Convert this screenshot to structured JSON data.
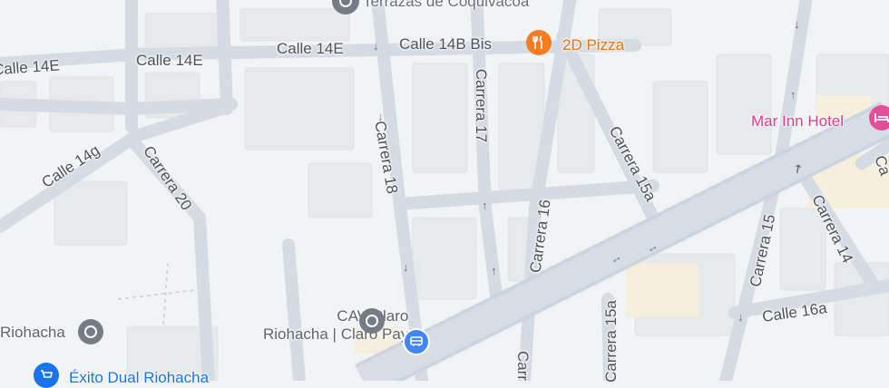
{
  "colors": {
    "land": "#f2f3f5",
    "block": "#e6e8eb",
    "road": "#d8dde3",
    "road_outline": "#cfd5dc",
    "main_road": "#c9d2dc",
    "label": "#4d5156",
    "poi_gray": "#757c85",
    "food": "#f57c1f",
    "hotel": "#e24e9a",
    "transit": "#4285f4",
    "shopping": "#1a73e8"
  },
  "streets": {
    "calle_14e_left": "Calle 14E",
    "calle_14e_mid": "Calle 14E",
    "calle_14e_right": "Calle 14E",
    "calle_14b_bis": "Calle 14B Bis",
    "calle_14g": "Calle 14g",
    "carrera_20": "Carrera 20",
    "carrera_18": "Carrera 18",
    "carrera_17": "Carrera 17",
    "carrera_16": "Carrera 16",
    "carrera_15a_top": "Carrera 15a",
    "carrera_15a_bottom": "Carrera 15a",
    "carrera_15": "Carrera 15",
    "carrera_14": "Carrera 14",
    "calle_16a": "Calle 16a",
    "carrera_cut_right": "Ca",
    "carrera_cut_bottom": "Carr"
  },
  "places": {
    "terrazas": {
      "name": "Terrazas de Coquivacoa",
      "icon": "pin-icon"
    },
    "pizza": {
      "name": "2D Pizza",
      "icon": "fork-knife-icon"
    },
    "hotel": {
      "name": "Mar Inn Hotel",
      "icon": "bed-icon"
    },
    "cav_claro": {
      "name_line1": "CAV Claro",
      "name_line2": "Riohacha | Claro Pay",
      "icon": "pin-icon"
    },
    "riohacha": {
      "name": "Riohacha",
      "icon": "pin-icon"
    },
    "exito": {
      "name": "Éxito Dual Riohacha",
      "icon": "shopping-cart-icon"
    },
    "bus_stop": {
      "icon": "bus-icon"
    }
  }
}
